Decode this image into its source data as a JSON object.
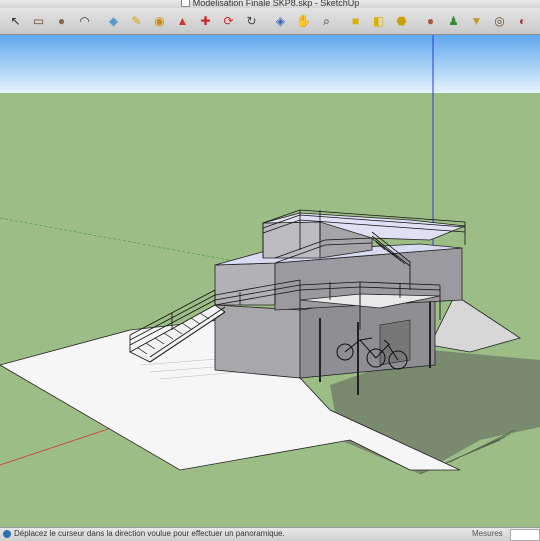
{
  "window": {
    "title": "Modelisation Finale SKP8.skp - SketchUp"
  },
  "toolbar": {
    "tools": [
      {
        "name": "select-tool-icon",
        "glyph": "↖",
        "color": "#222222"
      },
      {
        "name": "rectangle-tool-icon",
        "glyph": "▭",
        "color": "#6b4a2b"
      },
      {
        "name": "circle-tool-icon",
        "glyph": "●",
        "color": "#8a6a45"
      },
      {
        "name": "arc-tool-icon",
        "glyph": "◠",
        "color": "#333333"
      },
      {
        "name": "eraser-tool-icon",
        "glyph": "◆",
        "color": "#5e9ad1"
      },
      {
        "name": "tape-measure-icon",
        "glyph": "✎",
        "color": "#d6a400"
      },
      {
        "name": "paint-bucket-icon",
        "glyph": "◉",
        "color": "#cc8a00"
      },
      {
        "name": "push-pull-icon",
        "glyph": "▲",
        "color": "#c83a2a"
      },
      {
        "name": "move-tool-icon",
        "glyph": "✚",
        "color": "#c82828"
      },
      {
        "name": "rotate-tool-icon",
        "glyph": "⟳",
        "color": "#c82828"
      },
      {
        "name": "follow-me-icon",
        "glyph": "↻",
        "color": "#444444"
      },
      {
        "name": "orbit-tool-icon",
        "glyph": "◈",
        "color": "#3a63b8"
      },
      {
        "name": "pan-tool-icon",
        "glyph": "✋",
        "color": "#222222"
      },
      {
        "name": "zoom-tool-icon",
        "glyph": "⌕",
        "color": "#222222"
      },
      {
        "name": "component-icon",
        "glyph": "■",
        "color": "#d9b200"
      },
      {
        "name": "warehouse-icon",
        "glyph": "◧",
        "color": "#d9b200"
      },
      {
        "name": "get-models-icon",
        "glyph": "⬣",
        "color": "#c8a000"
      },
      {
        "name": "user-icon",
        "glyph": "●",
        "color": "#a25a3a"
      },
      {
        "name": "walk-icon",
        "glyph": "♟",
        "color": "#3a8a3a"
      },
      {
        "name": "position-camera-icon",
        "glyph": "▼",
        "color": "#c79a2a"
      },
      {
        "name": "look-around-icon",
        "glyph": "◎",
        "color": "#6a4a2a"
      },
      {
        "name": "section-plane-icon",
        "glyph": "◐",
        "color": "#a04040"
      }
    ]
  },
  "status": {
    "message": "Déplacez le curseur dans la direction voulue pour effectuer un panoramique.",
    "measurements_label": "Mesures",
    "measurements_value": ""
  }
}
